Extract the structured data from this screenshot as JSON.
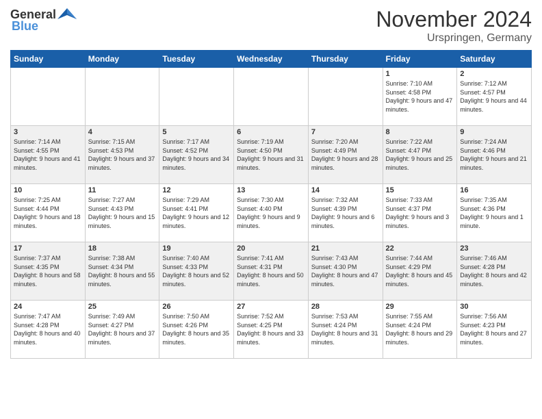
{
  "header": {
    "logo_general": "General",
    "logo_blue": "Blue",
    "month_title": "November 2024",
    "location": "Urspringen, Germany"
  },
  "weekdays": [
    "Sunday",
    "Monday",
    "Tuesday",
    "Wednesday",
    "Thursday",
    "Friday",
    "Saturday"
  ],
  "weeks": [
    [
      {
        "day": "",
        "info": ""
      },
      {
        "day": "",
        "info": ""
      },
      {
        "day": "",
        "info": ""
      },
      {
        "day": "",
        "info": ""
      },
      {
        "day": "",
        "info": ""
      },
      {
        "day": "1",
        "info": "Sunrise: 7:10 AM\nSunset: 4:58 PM\nDaylight: 9 hours and 47 minutes."
      },
      {
        "day": "2",
        "info": "Sunrise: 7:12 AM\nSunset: 4:57 PM\nDaylight: 9 hours and 44 minutes."
      }
    ],
    [
      {
        "day": "3",
        "info": "Sunrise: 7:14 AM\nSunset: 4:55 PM\nDaylight: 9 hours and 41 minutes."
      },
      {
        "day": "4",
        "info": "Sunrise: 7:15 AM\nSunset: 4:53 PM\nDaylight: 9 hours and 37 minutes."
      },
      {
        "day": "5",
        "info": "Sunrise: 7:17 AM\nSunset: 4:52 PM\nDaylight: 9 hours and 34 minutes."
      },
      {
        "day": "6",
        "info": "Sunrise: 7:19 AM\nSunset: 4:50 PM\nDaylight: 9 hours and 31 minutes."
      },
      {
        "day": "7",
        "info": "Sunrise: 7:20 AM\nSunset: 4:49 PM\nDaylight: 9 hours and 28 minutes."
      },
      {
        "day": "8",
        "info": "Sunrise: 7:22 AM\nSunset: 4:47 PM\nDaylight: 9 hours and 25 minutes."
      },
      {
        "day": "9",
        "info": "Sunrise: 7:24 AM\nSunset: 4:46 PM\nDaylight: 9 hours and 21 minutes."
      }
    ],
    [
      {
        "day": "10",
        "info": "Sunrise: 7:25 AM\nSunset: 4:44 PM\nDaylight: 9 hours and 18 minutes."
      },
      {
        "day": "11",
        "info": "Sunrise: 7:27 AM\nSunset: 4:43 PM\nDaylight: 9 hours and 15 minutes."
      },
      {
        "day": "12",
        "info": "Sunrise: 7:29 AM\nSunset: 4:41 PM\nDaylight: 9 hours and 12 minutes."
      },
      {
        "day": "13",
        "info": "Sunrise: 7:30 AM\nSunset: 4:40 PM\nDaylight: 9 hours and 9 minutes."
      },
      {
        "day": "14",
        "info": "Sunrise: 7:32 AM\nSunset: 4:39 PM\nDaylight: 9 hours and 6 minutes."
      },
      {
        "day": "15",
        "info": "Sunrise: 7:33 AM\nSunset: 4:37 PM\nDaylight: 9 hours and 3 minutes."
      },
      {
        "day": "16",
        "info": "Sunrise: 7:35 AM\nSunset: 4:36 PM\nDaylight: 9 hours and 1 minute."
      }
    ],
    [
      {
        "day": "17",
        "info": "Sunrise: 7:37 AM\nSunset: 4:35 PM\nDaylight: 8 hours and 58 minutes."
      },
      {
        "day": "18",
        "info": "Sunrise: 7:38 AM\nSunset: 4:34 PM\nDaylight: 8 hours and 55 minutes."
      },
      {
        "day": "19",
        "info": "Sunrise: 7:40 AM\nSunset: 4:33 PM\nDaylight: 8 hours and 52 minutes."
      },
      {
        "day": "20",
        "info": "Sunrise: 7:41 AM\nSunset: 4:31 PM\nDaylight: 8 hours and 50 minutes."
      },
      {
        "day": "21",
        "info": "Sunrise: 7:43 AM\nSunset: 4:30 PM\nDaylight: 8 hours and 47 minutes."
      },
      {
        "day": "22",
        "info": "Sunrise: 7:44 AM\nSunset: 4:29 PM\nDaylight: 8 hours and 45 minutes."
      },
      {
        "day": "23",
        "info": "Sunrise: 7:46 AM\nSunset: 4:28 PM\nDaylight: 8 hours and 42 minutes."
      }
    ],
    [
      {
        "day": "24",
        "info": "Sunrise: 7:47 AM\nSunset: 4:28 PM\nDaylight: 8 hours and 40 minutes."
      },
      {
        "day": "25",
        "info": "Sunrise: 7:49 AM\nSunset: 4:27 PM\nDaylight: 8 hours and 37 minutes."
      },
      {
        "day": "26",
        "info": "Sunrise: 7:50 AM\nSunset: 4:26 PM\nDaylight: 8 hours and 35 minutes."
      },
      {
        "day": "27",
        "info": "Sunrise: 7:52 AM\nSunset: 4:25 PM\nDaylight: 8 hours and 33 minutes."
      },
      {
        "day": "28",
        "info": "Sunrise: 7:53 AM\nSunset: 4:24 PM\nDaylight: 8 hours and 31 minutes."
      },
      {
        "day": "29",
        "info": "Sunrise: 7:55 AM\nSunset: 4:24 PM\nDaylight: 8 hours and 29 minutes."
      },
      {
        "day": "30",
        "info": "Sunrise: 7:56 AM\nSunset: 4:23 PM\nDaylight: 8 hours and 27 minutes."
      }
    ]
  ]
}
